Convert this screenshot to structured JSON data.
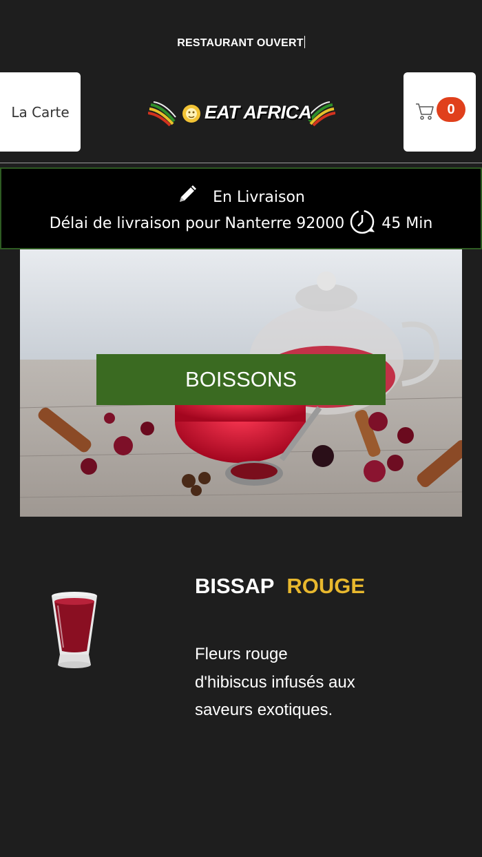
{
  "status": {
    "text": "RESTAURANT OUVERT"
  },
  "nav": {
    "menu_label": "La Carte",
    "brand": "EAT AFRICA",
    "cart_count": "0"
  },
  "delivery": {
    "mode": "En Livraison",
    "delay_text": "Délai de livraison pour Nanterre 92000",
    "duration": "45 Min"
  },
  "category": {
    "label": "BOISSONS"
  },
  "product": {
    "name_primary": "BISSAP",
    "name_accent": "ROUGE",
    "description": "Fleurs rouge d'hibiscus infusés aux saveurs exotiques."
  },
  "colors": {
    "background": "#1e1e1e",
    "category_button": "#3a6a21",
    "accent": "#e8b82e",
    "cart_badge": "#e0401c",
    "delivery_border": "#2e5b22"
  },
  "icons": [
    "shopping-cart-icon",
    "pencil-icon",
    "clock-icon",
    "lion-logo-icon"
  ]
}
